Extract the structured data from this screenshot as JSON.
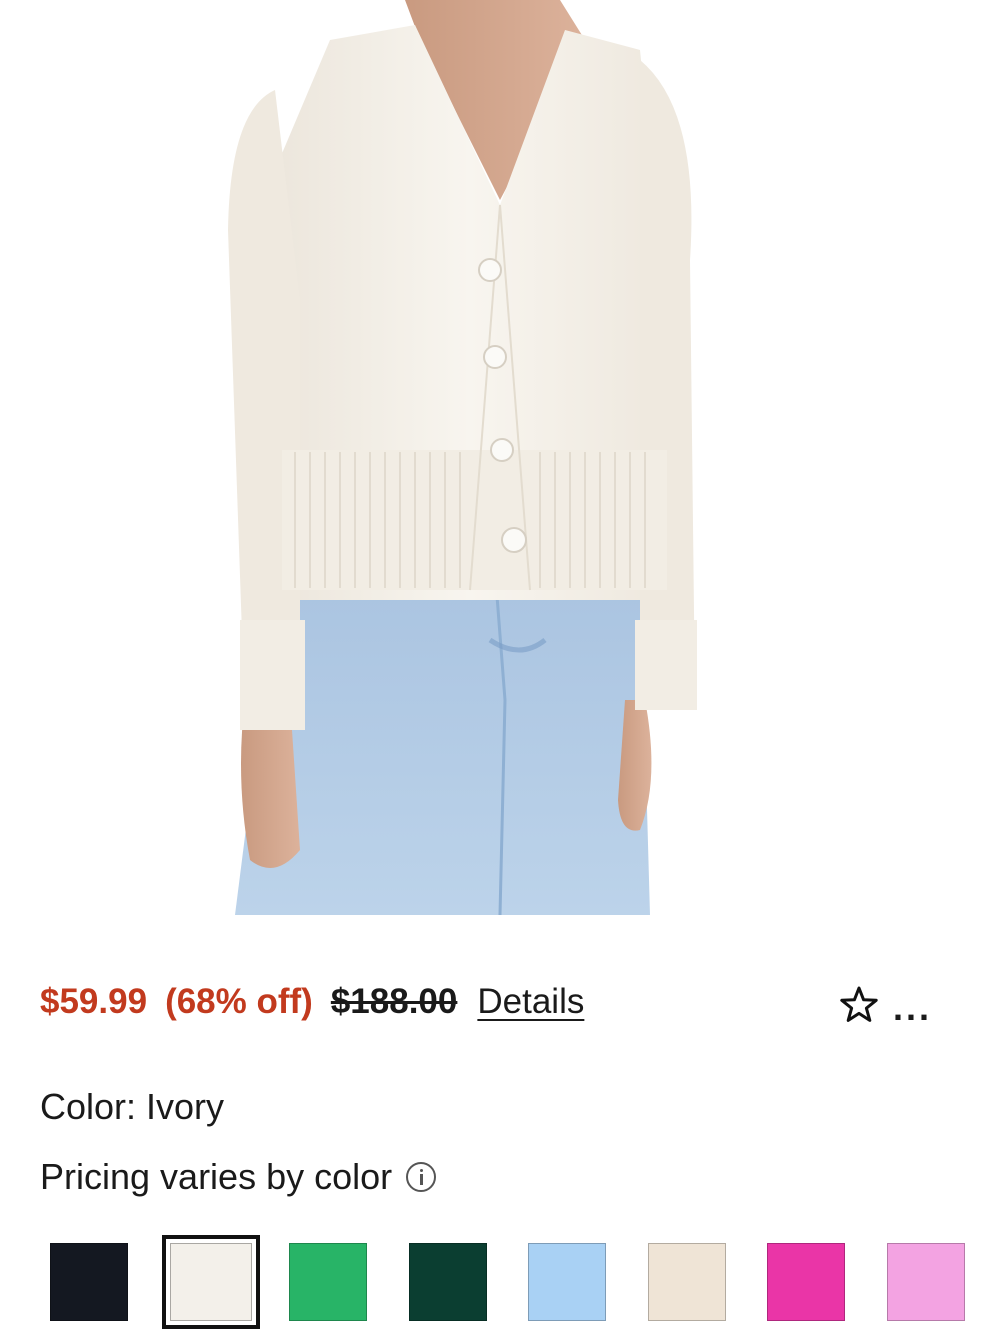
{
  "product": {
    "sale_price": "$59.99",
    "discount": "(68% off)",
    "original_price": "$188.00",
    "details_link": "Details",
    "favorite_icon": "star-outline-icon",
    "more_label": "..."
  },
  "color": {
    "label": "Color: Ivory",
    "pricing_note": "Pricing varies by color",
    "info_icon": "info-icon",
    "swatches": [
      {
        "name": "black",
        "hex": "#141821",
        "selected": false
      },
      {
        "name": "ivory",
        "hex": "#f3f0ea",
        "selected": true
      },
      {
        "name": "green",
        "hex": "#28b467",
        "selected": false
      },
      {
        "name": "dark-green",
        "hex": "#0b3e31",
        "selected": false
      },
      {
        "name": "light-blue",
        "hex": "#a9d1f4",
        "selected": false
      },
      {
        "name": "oatmeal",
        "hex": "#efe4d6",
        "selected": false
      },
      {
        "name": "hot-pink",
        "hex": "#ea35a7",
        "selected": false
      },
      {
        "name": "light-pink",
        "hex": "#f3a3e2",
        "selected": false
      }
    ]
  },
  "colors": {
    "sale_red": "#c23a1e"
  }
}
